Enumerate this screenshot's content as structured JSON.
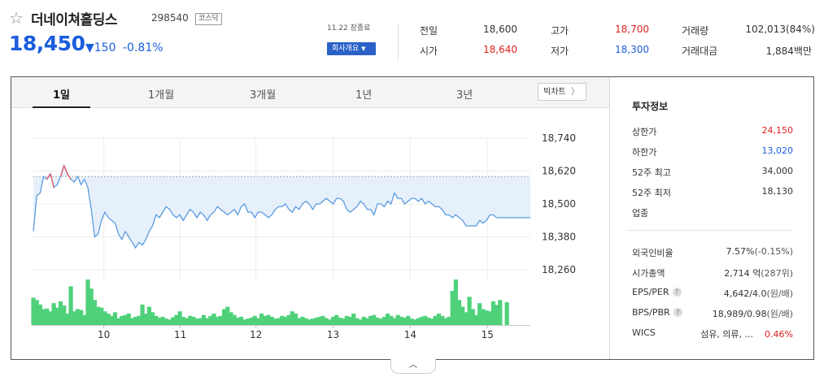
{
  "header": {
    "name": "더네이쳐홀딩스",
    "code": "298540",
    "market": "코스닥",
    "price": "18,450",
    "change": "▼150",
    "change_pct": "-0.81%",
    "date_note": "11.22 장종료",
    "company_button": "회사개요",
    "star_icon": "star-outline-icon"
  },
  "quote": {
    "prev_label": "전일",
    "prev": "18,600",
    "open_label": "시가",
    "open": "18,640",
    "high_label": "고가",
    "high": "18,700",
    "low_label": "저가",
    "low": "18,300",
    "volume_label": "거래량",
    "volume": "102,013(84%)",
    "amount_label": "거래대금",
    "amount": "1,884백만"
  },
  "tabs": [
    "1일",
    "1개월",
    "3개월",
    "1년",
    "3년"
  ],
  "active_tab": "1일",
  "bigchart_label": "빅차트",
  "info": {
    "title": "투자정보",
    "upper_label": "상한가",
    "upper": "24,150",
    "lower_label": "하한가",
    "lower": "13,020",
    "w52_high_label": "52주 최고",
    "w52_high": "34,000",
    "w52_low_label": "52주 최저",
    "w52_low": "18,130",
    "industry_label": "업종",
    "foreign_label": "외국인비율",
    "foreign": "7.57%",
    "foreign_sub": "(-0.15%)",
    "mcap_label": "시가총액",
    "mcap": "2,714 억",
    "mcap_sub": "(287위)",
    "eps_label": "EPS/PER",
    "eps": "4,642/4.0",
    "eps_sub": "(원/배)",
    "bps_label": "BPS/PBR",
    "bps": "18,989/0.98",
    "bps_sub": "(원/배)",
    "wics_label": "WICS",
    "wics": "섬유, 의류, ...",
    "wics_pct": "0.46%"
  },
  "colors": {
    "up": "#e02020",
    "down": "#1a5ddd",
    "line": "#5b9be0",
    "area": "#e6f0fb",
    "volume": "#4fd17a"
  },
  "chart_data": {
    "type": "line",
    "ylim": [
      18200,
      18800
    ],
    "yticks": [
      "18,740",
      "18,620",
      "18,500",
      "18,380",
      "18,260"
    ],
    "ytick_values": [
      18740,
      18620,
      18500,
      18380,
      18260
    ],
    "xticks": [
      "10",
      "11",
      "12",
      "13",
      "14",
      "15"
    ],
    "xtick_positions": [
      8.95,
      18.55,
      28.05,
      37.74,
      47.42,
      57.11
    ],
    "x_range": [
      0,
      62.5
    ],
    "prev_close": 18600,
    "prices": [
      18400,
      18530,
      18540,
      18600,
      18590,
      18610,
      18560,
      18570,
      18600,
      18640,
      18610,
      18590,
      18580,
      18600,
      18570,
      18590,
      18560,
      18480,
      18380,
      18390,
      18440,
      18470,
      18450,
      18440,
      18430,
      18390,
      18370,
      18400,
      18380,
      18360,
      18340,
      18360,
      18350,
      18370,
      18400,
      18420,
      18460,
      18450,
      18470,
      18490,
      18480,
      18460,
      18450,
      18460,
      18440,
      18460,
      18480,
      18470,
      18450,
      18470,
      18460,
      18440,
      18460,
      18470,
      18490,
      18480,
      18470,
      18460,
      18470,
      18480,
      18460,
      18490,
      18500,
      18470,
      18470,
      18450,
      18470,
      18470,
      18460,
      18450,
      18460,
      18480,
      18490,
      18490,
      18500,
      18480,
      18470,
      18490,
      18480,
      18500,
      18510,
      18500,
      18480,
      18500,
      18500,
      18510,
      18520,
      18510,
      18500,
      18520,
      18520,
      18510,
      18480,
      18470,
      18480,
      18490,
      18510,
      18500,
      18480,
      18480,
      18460,
      18500,
      18500,
      18490,
      18510,
      18500,
      18540,
      18520,
      18520,
      18500,
      18510,
      18520,
      18520,
      18510,
      18520,
      18500,
      18510,
      18500,
      18490,
      18490,
      18480,
      18460,
      18460,
      18450,
      18460,
      18450,
      18440,
      18420,
      18420,
      18420,
      18420,
      18440,
      18430,
      18440,
      18460,
      18460,
      18450,
      18450,
      18450
    ],
    "volumes": [
      60,
      55,
      45,
      35,
      36,
      30,
      48,
      38,
      52,
      43,
      25,
      85,
      30,
      35,
      33,
      22,
      100,
      80,
      55,
      40,
      38,
      30,
      25,
      20,
      28,
      15,
      20,
      22,
      25,
      15,
      18,
      20,
      45,
      25,
      40,
      28,
      20,
      16,
      18,
      14,
      12,
      17,
      22,
      30,
      18,
      15,
      20,
      18,
      14,
      15,
      22,
      15,
      20,
      25,
      18,
      20,
      35,
      40,
      28,
      22,
      16,
      18,
      12,
      14,
      16,
      20,
      15,
      25,
      20,
      22,
      18,
      14,
      15,
      20,
      18,
      22,
      30,
      25,
      15,
      18,
      15,
      12,
      14,
      16,
      18,
      20,
      15,
      12,
      18,
      22,
      16,
      14,
      20,
      18,
      25,
      15,
      12,
      18,
      15,
      20,
      22,
      16,
      14,
      18,
      25,
      20,
      15,
      22,
      18,
      16,
      20,
      14,
      12,
      15,
      18,
      20,
      16,
      14,
      20,
      25,
      20,
      15,
      18,
      75,
      100,
      55,
      40,
      28,
      62,
      35,
      22,
      48,
      35,
      32,
      30,
      52,
      44,
      55,
      0,
      50
    ]
  }
}
